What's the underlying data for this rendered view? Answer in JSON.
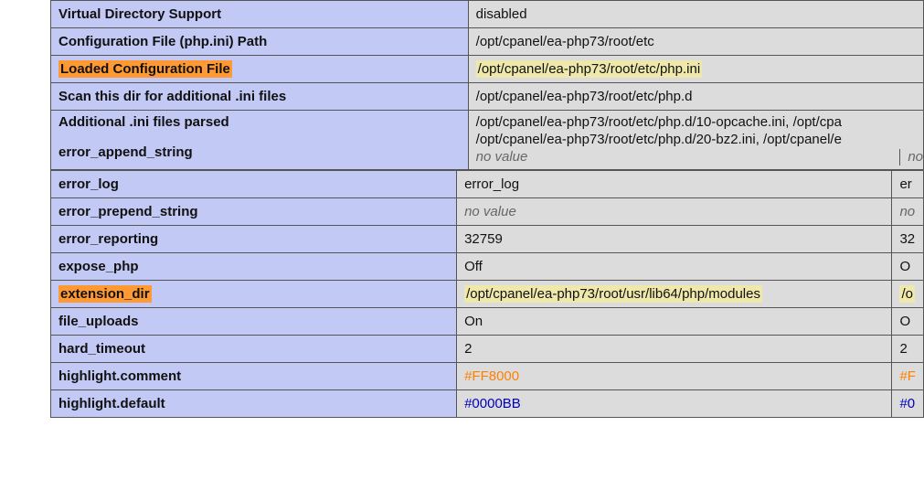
{
  "top_table": {
    "rows": [
      {
        "key": "Virtual Directory Support",
        "val": "disabled",
        "keyhl": false,
        "valhl": false
      },
      {
        "key": "Configuration File (php.ini) Path",
        "val": "/opt/cpanel/ea-php73/root/etc",
        "keyhl": false,
        "valhl": false
      },
      {
        "key": "Loaded Configuration File",
        "val": "/opt/cpanel/ea-php73/root/etc/php.ini",
        "keyhl": true,
        "valhl": true
      },
      {
        "key": "Scan this dir for additional .ini files",
        "val": "/opt/cpanel/ea-php73/root/etc/php.d",
        "keyhl": false,
        "valhl": false
      }
    ],
    "merged": {
      "key1": "Additional .ini files parsed",
      "key2": "error_append_string",
      "val_line1": "/opt/cpanel/ea-php73/root/etc/php.d/10-opcache.ini, /opt/cpa",
      "val_line2": "/opt/cpanel/ea-php73/root/etc/php.d/20-bz2.ini, /opt/cpanel/e",
      "noval": "no value",
      "noval2": "no"
    }
  },
  "bottom_table": {
    "rows": [
      {
        "key": "error_log",
        "v1": "error_log",
        "v2": "er",
        "keyhl": false,
        "valhl": false,
        "italic": false,
        "color": ""
      },
      {
        "key": "error_prepend_string",
        "v1": "no value",
        "v2": "no",
        "keyhl": false,
        "valhl": false,
        "italic": true,
        "color": ""
      },
      {
        "key": "error_reporting",
        "v1": "32759",
        "v2": "32",
        "keyhl": false,
        "valhl": false,
        "italic": false,
        "color": ""
      },
      {
        "key": "expose_php",
        "v1": "Off",
        "v2": "O",
        "keyhl": false,
        "valhl": false,
        "italic": false,
        "color": ""
      },
      {
        "key": "extension_dir",
        "v1": "/opt/cpanel/ea-php73/root/usr/lib64/php/modules",
        "v2": "/o",
        "keyhl": true,
        "valhl": true,
        "italic": false,
        "color": ""
      },
      {
        "key": "file_uploads",
        "v1": "On",
        "v2": "O",
        "keyhl": false,
        "valhl": false,
        "italic": false,
        "color": ""
      },
      {
        "key": "hard_timeout",
        "v1": "2",
        "v2": "2",
        "keyhl": false,
        "valhl": false,
        "italic": false,
        "color": ""
      },
      {
        "key": "highlight.comment",
        "v1": "#FF8000",
        "v2": "#F",
        "keyhl": false,
        "valhl": false,
        "italic": false,
        "color": "orange"
      },
      {
        "key": "highlight.default",
        "v1": "#0000BB",
        "v2": "#0",
        "keyhl": false,
        "valhl": false,
        "italic": false,
        "color": "blue"
      }
    ]
  }
}
